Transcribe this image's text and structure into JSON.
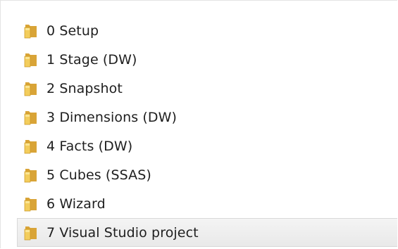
{
  "folders": [
    {
      "label": "0 Setup",
      "icon": "folder-icon",
      "selected": false
    },
    {
      "label": "1 Stage (DW)",
      "icon": "folder-icon",
      "selected": false
    },
    {
      "label": "2 Snapshot",
      "icon": "folder-icon",
      "selected": false
    },
    {
      "label": "3 Dimensions (DW)",
      "icon": "folder-icon",
      "selected": false
    },
    {
      "label": "4 Facts (DW)",
      "icon": "folder-icon",
      "selected": false
    },
    {
      "label": "5 Cubes (SSAS)",
      "icon": "folder-icon",
      "selected": false
    },
    {
      "label": "6 Wizard",
      "icon": "folder-icon",
      "selected": false
    },
    {
      "label": "7 Visual Studio project",
      "icon": "folder-icon",
      "selected": true
    }
  ],
  "colors": {
    "folder_back": "#d9a437",
    "folder_front": "#f3cd5c",
    "folder_highlight": "#fbe594",
    "selection_border": "#d9d9d9"
  }
}
